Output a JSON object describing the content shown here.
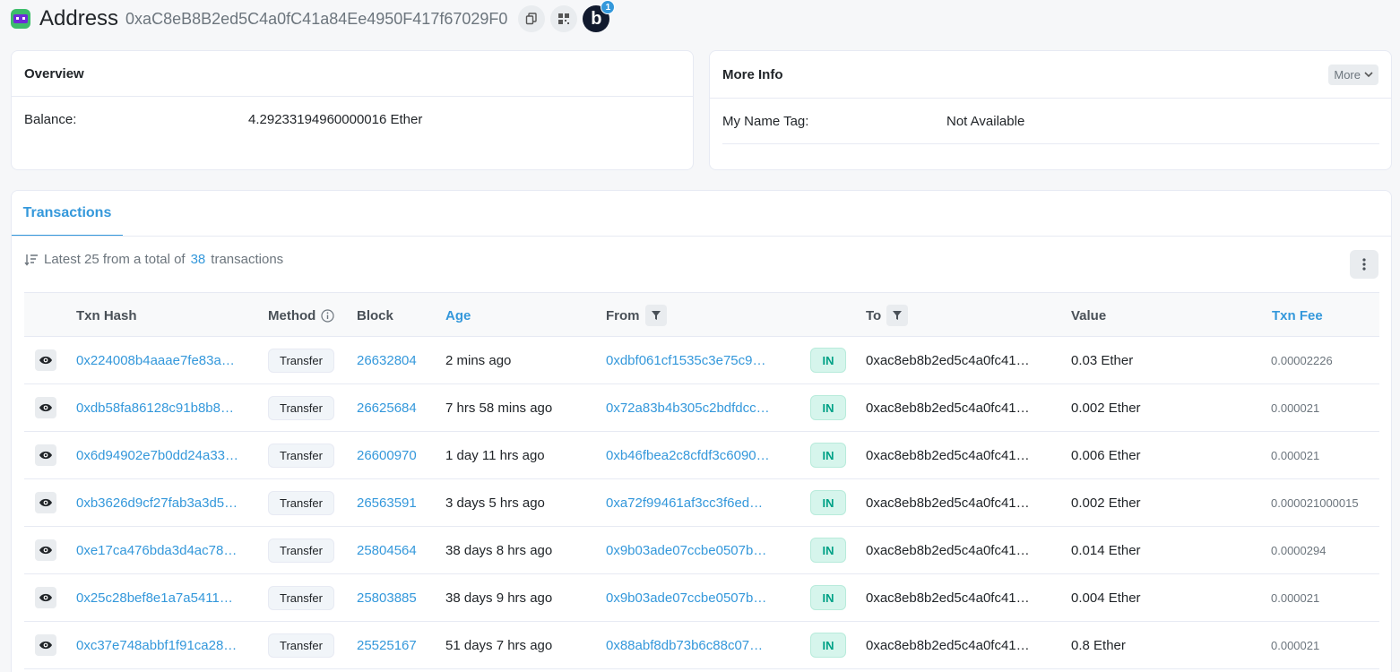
{
  "header": {
    "title": "Address",
    "address": "0xaC8eB8B2ed5C4a0fC41a84Ee4950F417f67029F0",
    "badge_letter": "b",
    "badge_count": "1"
  },
  "overview": {
    "title": "Overview",
    "balance_label": "Balance:",
    "balance_value": "4.29233194960000016 Ether"
  },
  "more_info": {
    "title": "More Info",
    "more_button": "More",
    "name_tag_label": "My Name Tag:",
    "name_tag_value": "Not Available"
  },
  "transactions": {
    "tab_label": "Transactions",
    "summary_prefix": "Latest 25 from a total of",
    "summary_count": "38",
    "summary_suffix": "transactions",
    "columns": {
      "hash": "Txn Hash",
      "method": "Method",
      "block": "Block",
      "age": "Age",
      "from": "From",
      "to": "To",
      "value": "Value",
      "fee": "Txn Fee"
    },
    "rows": [
      {
        "hash": "0x224008b4aaae7fe83a…",
        "method": "Transfer",
        "block": "26632804",
        "age": "2 mins ago",
        "from": "0xdbf061cf1535c3e75c9…",
        "dir": "IN",
        "to": "0xac8eb8b2ed5c4a0fc41…",
        "value": "0.03 Ether",
        "fee": "0.00002226"
      },
      {
        "hash": "0xdb58fa86128c91b8b8…",
        "method": "Transfer",
        "block": "26625684",
        "age": "7 hrs 58 mins ago",
        "from": "0x72a83b4b305c2bdfdcc…",
        "dir": "IN",
        "to": "0xac8eb8b2ed5c4a0fc41…",
        "value": "0.002 Ether",
        "fee": "0.000021"
      },
      {
        "hash": "0x6d94902e7b0dd24a33…",
        "method": "Transfer",
        "block": "26600970",
        "age": "1 day 11 hrs ago",
        "from": "0xb46fbea2c8cfdf3c6090…",
        "dir": "IN",
        "to": "0xac8eb8b2ed5c4a0fc41…",
        "value": "0.006 Ether",
        "fee": "0.000021"
      },
      {
        "hash": "0xb3626d9cf27fab3a3d5…",
        "method": "Transfer",
        "block": "26563591",
        "age": "3 days 5 hrs ago",
        "from": "0xa72f99461af3cc3f6ed…",
        "dir": "IN",
        "to": "0xac8eb8b2ed5c4a0fc41…",
        "value": "0.002 Ether",
        "fee": "0.000021000015"
      },
      {
        "hash": "0xe17ca476bda3d4ac78…",
        "method": "Transfer",
        "block": "25804564",
        "age": "38 days 8 hrs ago",
        "from": "0x9b03ade07ccbe0507b…",
        "dir": "IN",
        "to": "0xac8eb8b2ed5c4a0fc41…",
        "value": "0.014 Ether",
        "fee": "0.0000294"
      },
      {
        "hash": "0x25c28bef8e1a7a5411…",
        "method": "Transfer",
        "block": "25803885",
        "age": "38 days 9 hrs ago",
        "from": "0x9b03ade07ccbe0507b…",
        "dir": "IN",
        "to": "0xac8eb8b2ed5c4a0fc41…",
        "value": "0.004 Ether",
        "fee": "0.000021"
      },
      {
        "hash": "0xc37e748abbf1f91ca28…",
        "method": "Transfer",
        "block": "25525167",
        "age": "51 days 7 hrs ago",
        "from": "0x88abf8db73b6c88c07…",
        "dir": "IN",
        "to": "0xac8eb8b2ed5c4a0fc41…",
        "value": "0.8 Ether",
        "fee": "0.000021"
      }
    ]
  }
}
